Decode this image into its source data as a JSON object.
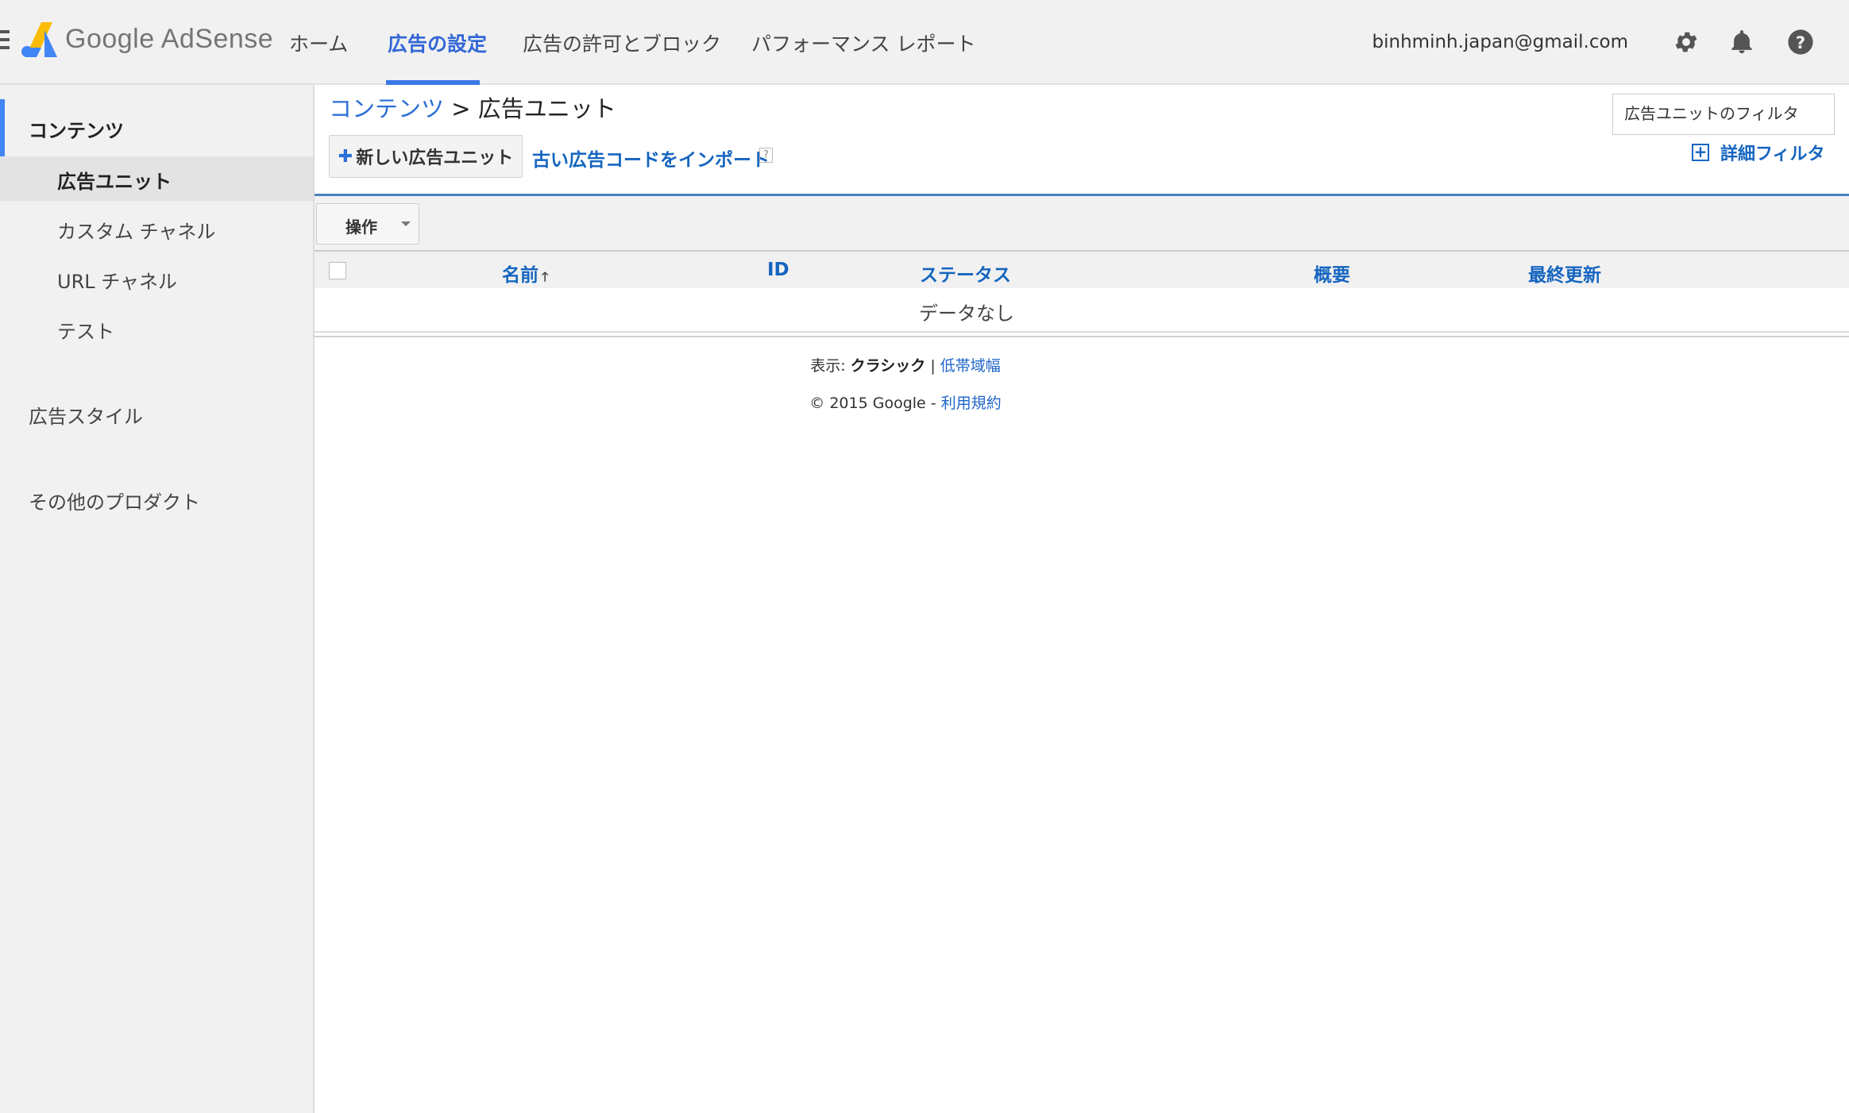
{
  "header": {
    "logo_text": "Google AdSense",
    "nav": [
      {
        "label": "ホーム"
      },
      {
        "label": "広告の設定"
      },
      {
        "label": "広告の許可とブロック"
      },
      {
        "label": "パフォーマンス レポート"
      }
    ],
    "active_nav": "広告の設定",
    "email": "binhminh.japan@gmail.com",
    "icons": [
      "menu-icon",
      "adsense-logo",
      "gear-icon",
      "bell-icon",
      "help-icon"
    ]
  },
  "sidebar": {
    "section_content": "コンテンツ",
    "items": [
      {
        "label": "広告ユニット",
        "selected": true
      },
      {
        "label": "カスタム チャネル"
      },
      {
        "label": "URL チャネル"
      },
      {
        "label": "テスト"
      }
    ],
    "section_styles": "広告スタイル",
    "section_other": "その他のプロダクト"
  },
  "main": {
    "breadcrumb": {
      "parent": "コンテンツ",
      "separator": ">",
      "current": "広告ユニット"
    },
    "new_ad_unit_label": "新しい広告ユニット",
    "import_label": "古い広告コードをインポート",
    "help_mark": "?",
    "filter_placeholder": "広告ユニットのフィルタ",
    "advanced_filter_label": "詳細フィルタ",
    "ops_label": "操作",
    "table": {
      "columns": [
        "名前",
        "ID",
        "ステータス",
        "概要",
        "最終更新"
      ],
      "empty_text": "データなし"
    },
    "footer": {
      "view_prefix": "表示:",
      "view_classic": "クラシック",
      "view_sep": "|",
      "view_lowbw": "低帯域幅",
      "copyright": "© 2015 Google -",
      "terms": "利用規約"
    }
  },
  "colors": {
    "accent": "#3b78e7",
    "link": "#1565c0",
    "bar_bg": "#f1f1f1"
  }
}
